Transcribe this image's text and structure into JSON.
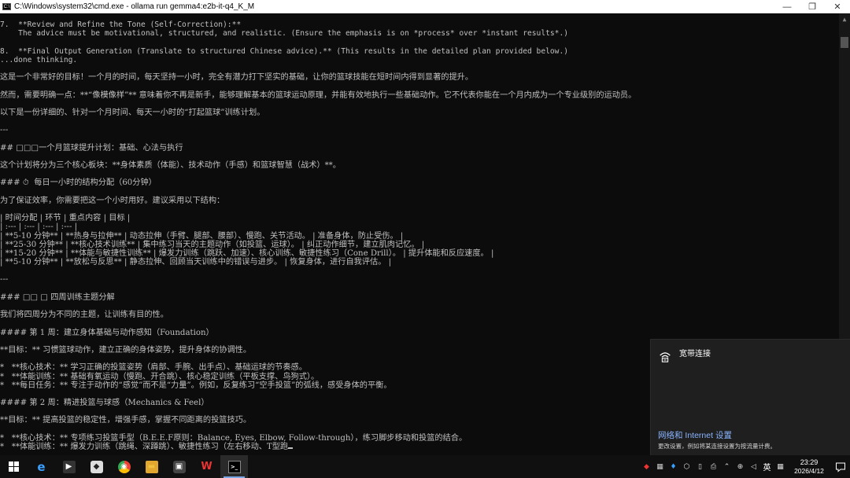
{
  "window": {
    "title": "C:\\Windows\\system32\\cmd.exe - ollama  run gemma4:e2b-it-q4_K_M",
    "minimize_glyph": "—",
    "maximize_glyph": "❐",
    "close_glyph": "✕"
  },
  "console": {
    "lines": [
      "7.  **Review and Refine the Tone (Self-Correction):**",
      "    The advice must be motivational, structured, and realistic. (Ensure the emphasis is on *process* over *instant results*.)",
      "",
      "8.  **Final Output Generation (Translate to structured Chinese advice).** (This results in the detailed plan provided below.)",
      "...done thinking.",
      "",
      "这是一个非常好的目标！一个月的时间，每天坚持一小时，完全有潜力打下坚实的基础，让你的篮球技能在短时间内得到显著的提升。",
      "",
      "然而，需要明确一点：**“像模像样”** 意味着你不再是新手，能够理解基本的篮球运动原理，并能有效地执行一些基础动作。它不代表你能在一个月内成为一个专业级别的运动员。",
      "",
      "以下是一份详细的、针对一个月时间、每天一小时的“打起篮球”训练计划。",
      "",
      "---",
      "",
      "## □□□一个月篮球提升计划：基础、心法与执行",
      "",
      "这个计划将分为三个核心板块：**身体素质（体能）、技术动作（手感）和篮球智慧（战术）**。",
      "",
      "### ⏱  每日一小时的结构分配（60分钟）",
      "",
      "为了保证效率，你需要把这一个小时用好。建议采用以下结构：",
      "",
      "| 时间分配 | 环节 | 重点内容 | 目标 |",
      "| :--- | :--- | :--- | :--- |",
      "| **5-10 分钟** | **热身与拉伸** | 动态拉伸（手臂、腿部、腰部）、慢跑、关节活动。 | 准备身体，防止受伤。 |",
      "| **25-30 分钟** | **核心技术训练** | 集中练习当天的主题动作（如投篮、运球）。 | 纠正动作细节，建立肌肉记忆。 |",
      "| **15-20 分钟** | **体能与敏捷性训练** | 爆发力训练（跳跃、加速）、核心训练、敏捷性练习（Cone Drill）。 | 提升体能和反应速度。 |",
      "| **5-10 分钟** | **放松与反思** | 静态拉伸、回顾当天训练中的错误与进步。 | 恢复身体，进行自我评估。 |",
      "",
      "---",
      "",
      "### □□ □ 四周训练主题分解",
      "",
      "我们将四周分为不同的主题，让训练有目的性。",
      "",
      "#### 第 1 周：建立身体基础与动作感知（Foundation）",
      "",
      "**目标：** 习惯篮球动作，建立正确的身体姿势，提升身体的协调性。",
      "",
      "*   **核心技术：** 学习正确的投篮姿势（肩部、手腕、出手点）、基础运球的节奏感。",
      "*   **体能训练：** 基础有氧运动（慢跑、开合跳）、核心稳定训练（平板支撑、鸟狗式）。",
      "*   **每日任务：** 专注于动作的“感觉”而不是“力量”。例如，反复练习“空手投篮”的弧线，感受身体的平衡。",
      "",
      "#### 第 2 周：精进投篮与球感（Mechanics & Feel）",
      "",
      "**目标：** 提高投篮的稳定性，增强手感，掌握不同距离的投篮技巧。",
      "",
      "*   **核心技术：** 专项练习投篮手型（B.E.E.F原则：Balance, Eyes, Elbow, Follow-through），练习脚步移动和投篮的结合。",
      "*   **体能训练：** 爆发力训练（跳绳、深蹲跳）、敏捷性练习（左右移动、T型跑"
    ]
  },
  "network_flyout": {
    "network_name": "宽带连接",
    "settings_link": "网络和 Internet 设置",
    "settings_desc": "更改设置，例如将某连接设置为按流量计费。"
  },
  "taskbar": {
    "apps": [
      {
        "name": "start",
        "label": ""
      },
      {
        "name": "edge",
        "label": "e"
      },
      {
        "name": "app-dark",
        "label": "▶"
      },
      {
        "name": "app-notes",
        "label": "◆"
      },
      {
        "name": "chrome",
        "label": "◉"
      },
      {
        "name": "file-explorer",
        "label": "▬"
      },
      {
        "name": "app-gallery",
        "label": "▣"
      },
      {
        "name": "wps",
        "label": "W"
      },
      {
        "name": "cmd",
        "label": ">_"
      }
    ],
    "tray": {
      "language": "英",
      "time": "23:29",
      "date": "2026/4/12"
    }
  }
}
